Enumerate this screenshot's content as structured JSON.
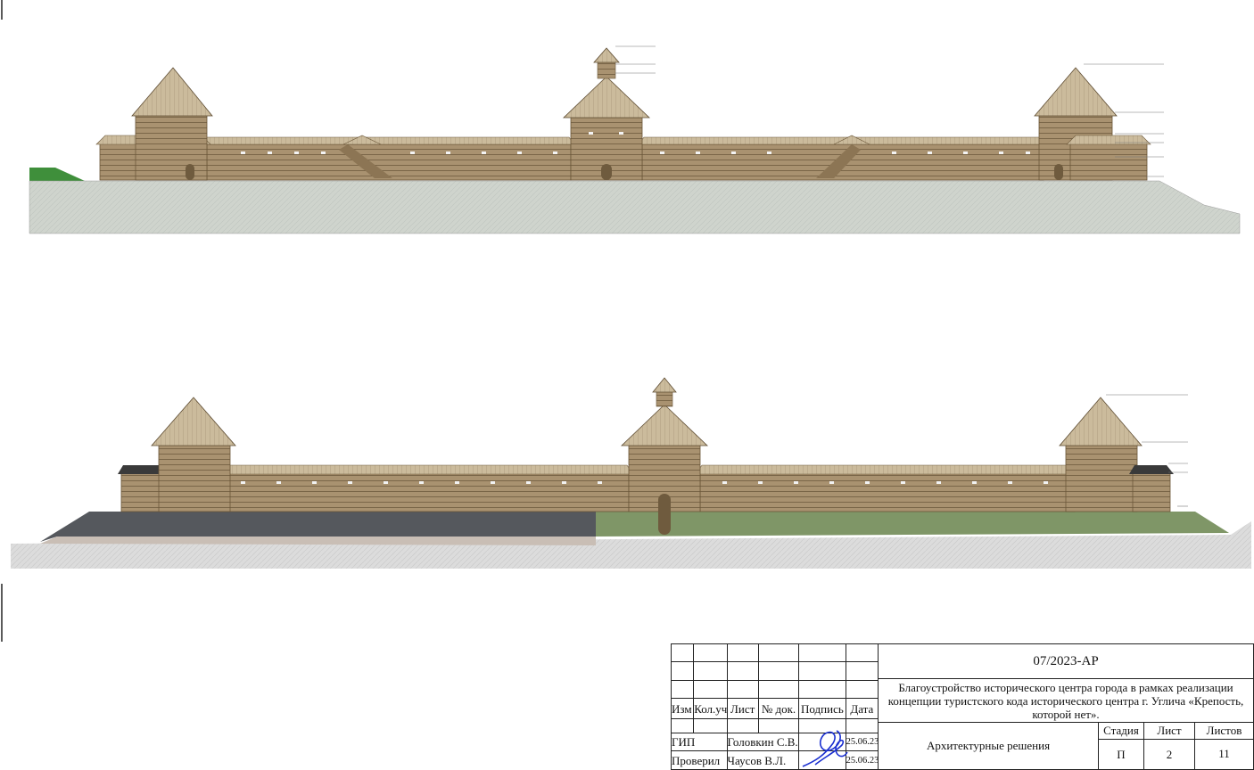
{
  "stamp": {
    "header": [
      "Изм",
      "Кол.уч",
      "Лист",
      "№ док.",
      "Подпись",
      "Дата"
    ],
    "rows": [
      {
        "role": "ГИП",
        "name": "Головкин С.В.",
        "date": "25.06.23"
      },
      {
        "role": "Проверил",
        "name": "Чаусов В.Л.",
        "date": "25.06.23"
      }
    ],
    "code": "07/2023-АР",
    "project": "Благоустройство исторического центра города в рамках реализации концепции туристского кода исторического центра г. Углича «Крепость, которой нет».",
    "section": "Архитектурные решения",
    "stage_label": "Стадия",
    "sheet_label": "Лист",
    "sheets_label": "Листов",
    "stage": "П",
    "sheet": "2",
    "sheets": "11"
  },
  "colors": {
    "wood": "#a08a66",
    "wood_dark": "#7b6647",
    "roof": "#c9b89a",
    "ground": "#cdd3cc",
    "grass": "#7d9468",
    "accent_green": "#3e8e3a"
  }
}
